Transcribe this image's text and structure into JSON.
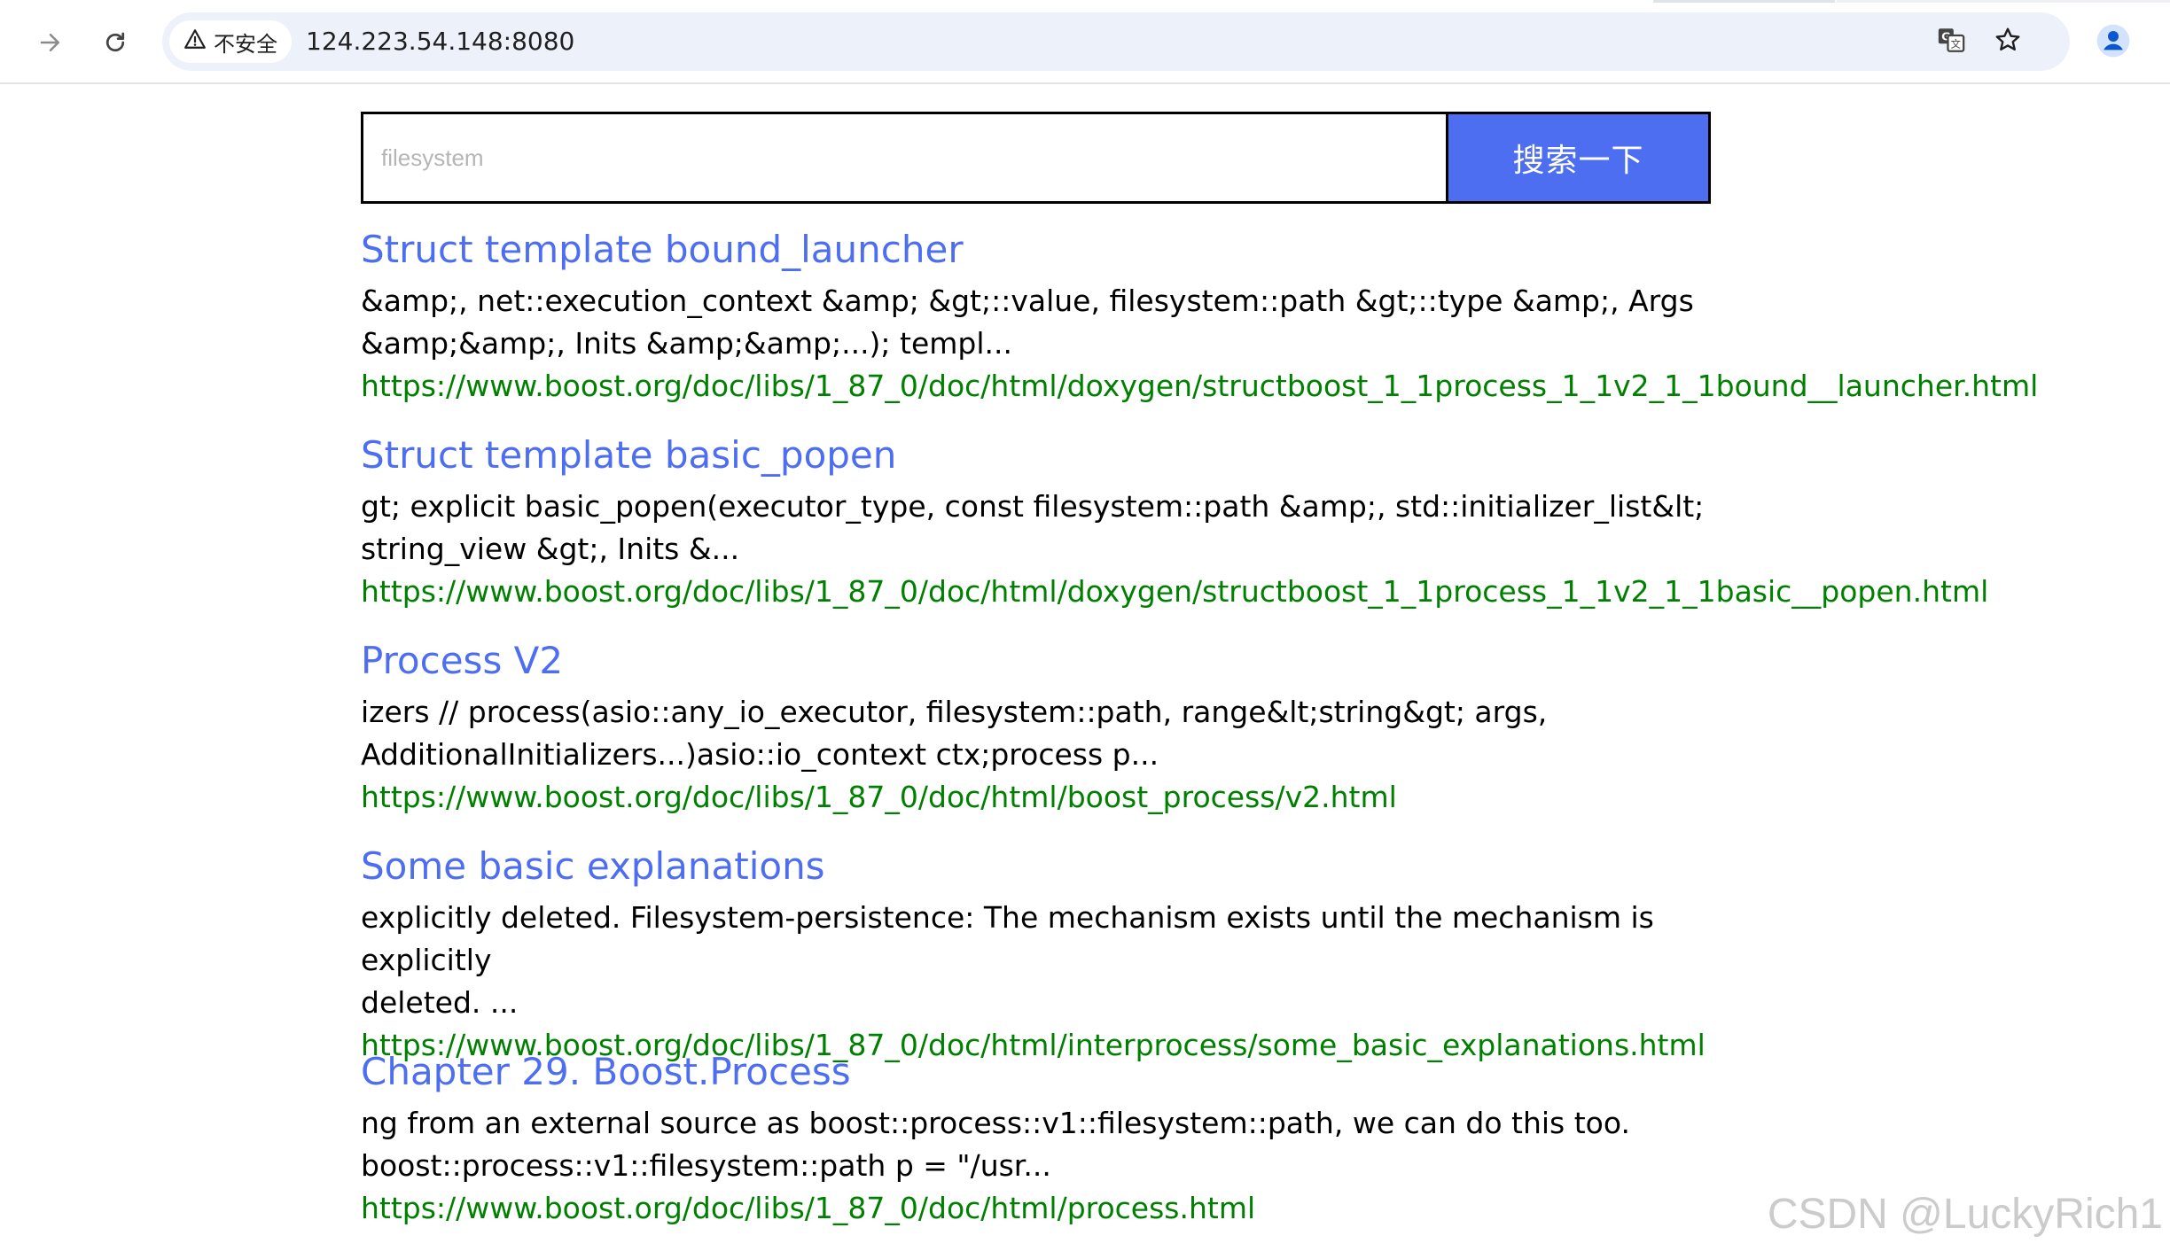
{
  "browser": {
    "security_label": "不安全",
    "url": "124.223.54.148:8080",
    "icons": {
      "forward": "arrow-forward-icon",
      "reload": "reload-icon",
      "warning": "warning-triangle-icon",
      "translate": "translate-icon",
      "bookmark": "star-icon",
      "profile": "profile-icon"
    }
  },
  "search": {
    "placeholder": "filesystem",
    "button_label": "搜索一下"
  },
  "colors": {
    "title": "#4e6ef2",
    "url": "#008000",
    "button": "#4e6ef2"
  },
  "results": [
    {
      "title": "Struct template bound_launcher",
      "desc_line1": "&amp;, net::execution_context &amp; &gt;::value, filesystem::path &gt;::type &amp;, Args",
      "desc_line2": "&amp;&amp;, Inits &amp;&amp;...); templ...",
      "url": "https://www.boost.org/doc/libs/1_87_0/doc/html/doxygen/structboost_1_1process_1_1v2_1_1bound__launcher.html"
    },
    {
      "title": "Struct template basic_popen",
      "desc_line1": "gt; explicit basic_popen(executor_type, const filesystem::path &amp;, std::initializer_list&lt;",
      "desc_line2": "string_view &gt;, Inits &...",
      "url": "https://www.boost.org/doc/libs/1_87_0/doc/html/doxygen/structboost_1_1process_1_1v2_1_1basic__popen.html"
    },
    {
      "title": "Process V2",
      "desc_line1": "izers // process(asio::any_io_executor, filesystem::path, range&lt;string&gt; args,",
      "desc_line2": "AdditionalInitializers...)asio::io_context ctx;process p...",
      "url": "https://www.boost.org/doc/libs/1_87_0/doc/html/boost_process/v2.html"
    },
    {
      "title": "Some basic explanations",
      "desc_line1": "explicitly deleted. Filesystem-persistence: The mechanism exists until the mechanism is explicitly",
      "desc_line2": "deleted. ...",
      "url": "https://www.boost.org/doc/libs/1_87_0/doc/html/interprocess/some_basic_explanations.html"
    },
    {
      "title": "Chapter 29. Boost.Process",
      "desc_line1": "ng from an external source as boost::process::v1::filesystem::path, we can do this too.",
      "desc_line2": "boost::process::v1::filesystem::path p = \"/usr...",
      "url": "https://www.boost.org/doc/libs/1_87_0/doc/html/process.html"
    }
  ],
  "watermark": "CSDN @LuckyRich1"
}
